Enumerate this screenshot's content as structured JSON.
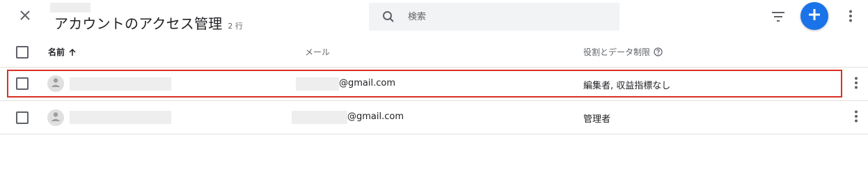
{
  "header": {
    "title": "アカウントのアクセス管理",
    "row_count": "2 行",
    "search_placeholder": "検索"
  },
  "columns": {
    "name": "名前",
    "email": "メール",
    "role": "役割とデータ制限"
  },
  "rows": [
    {
      "email": "@gmail.com",
      "role": "編集者, 収益指標なし",
      "highlighted": true
    },
    {
      "email": "@gmail.com",
      "role": "管理者",
      "highlighted": false
    }
  ],
  "colors": {
    "accent": "#1a73e8",
    "highlight_border": "#d93025",
    "icon_gray": "#5f6368"
  },
  "icons": [
    "close-icon",
    "search-icon",
    "filter-icon",
    "add-icon",
    "more-vert-icon",
    "sort-arrow-up-icon",
    "help-circle-icon",
    "person-icon"
  ]
}
